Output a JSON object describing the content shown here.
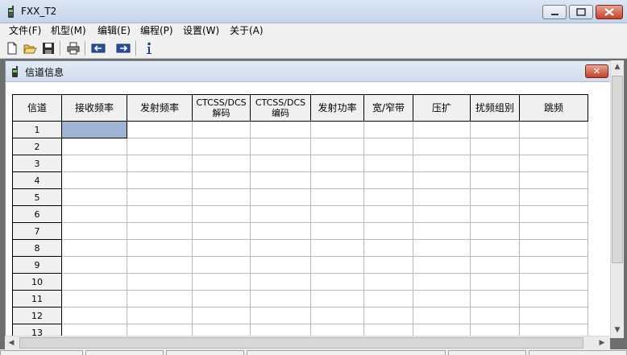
{
  "window": {
    "title": "FXX_T2"
  },
  "menu": [
    "文件(F)",
    "机型(M)",
    "编辑(E)",
    "编程(P)",
    "设置(W)",
    "关于(A)"
  ],
  "toolbar": [
    "new-icon",
    "open-icon",
    "save-icon",
    "print-icon",
    "read-from-radio-icon",
    "write-to-radio-icon",
    "info-icon"
  ],
  "child": {
    "title": "信道信息"
  },
  "table": {
    "columns": [
      {
        "label": "信道"
      },
      {
        "label": "接收频率"
      },
      {
        "label": "发射频率"
      },
      {
        "label": "CTCSS/DCS",
        "label2": "解码"
      },
      {
        "label": "CTCSS/DCS",
        "label2": "编码"
      },
      {
        "label": "发射功率"
      },
      {
        "label": "宽/窄带"
      },
      {
        "label": "压扩"
      },
      {
        "label": "扰频组别"
      },
      {
        "label": "跳频"
      }
    ],
    "rows": [
      "1",
      "2",
      "3",
      "4",
      "5",
      "6",
      "7",
      "8",
      "9",
      "10",
      "11",
      "12",
      "13"
    ]
  },
  "colors": {
    "selected_cell": "#9db4d2",
    "title_gradient": "#c4d5ea"
  }
}
